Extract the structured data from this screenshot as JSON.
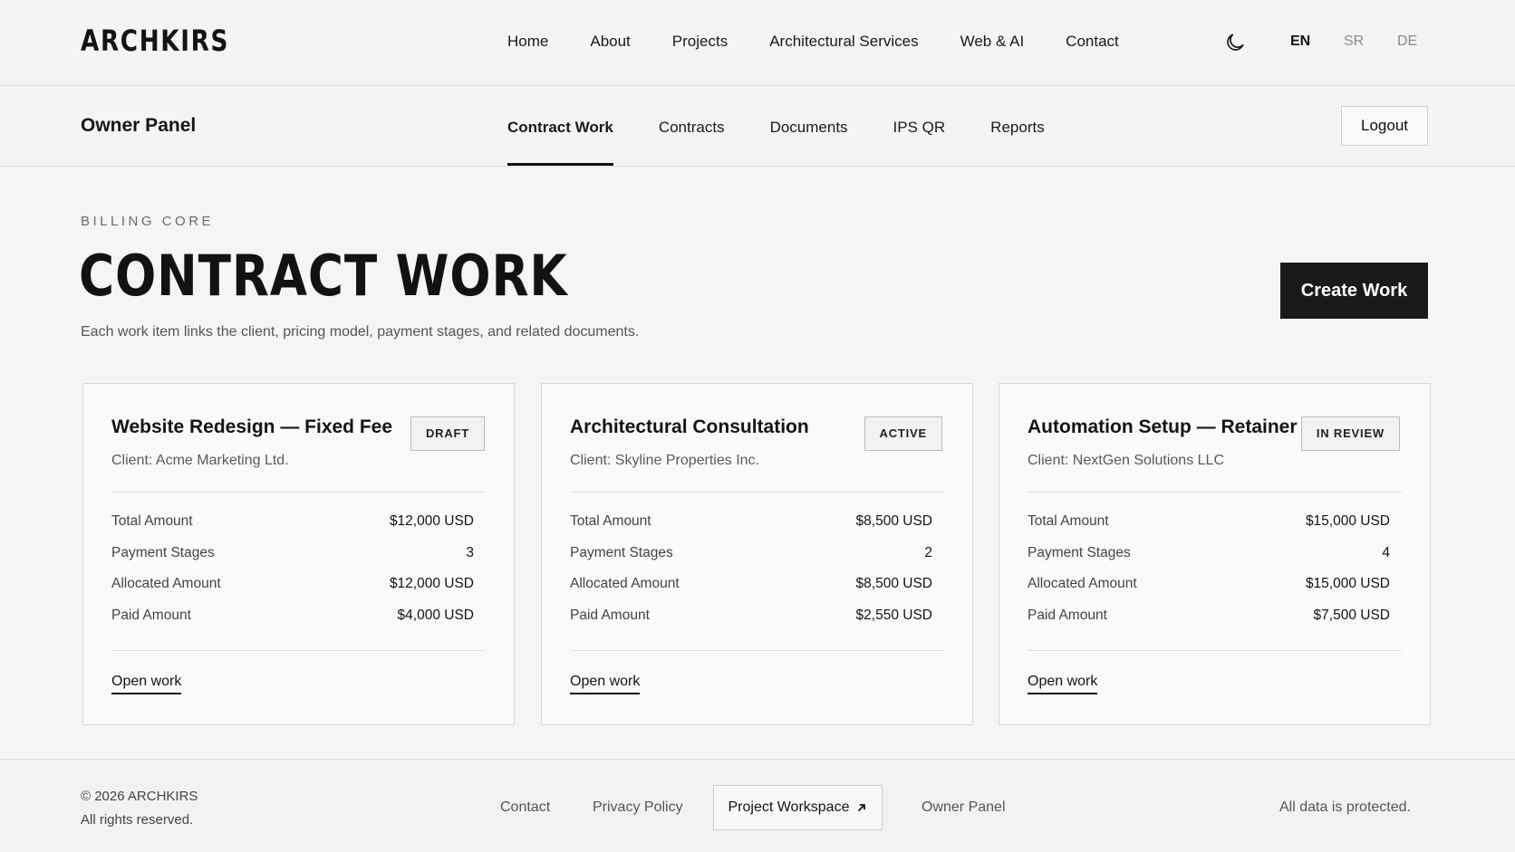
{
  "header": {
    "logo": "ARCHKIRS",
    "nav": [
      "Home",
      "About",
      "Projects",
      "Architectural Services",
      "Web & AI",
      "Contact"
    ],
    "theme_icon": "moon-icon",
    "languages": [
      "EN",
      "SR",
      "DE"
    ],
    "active_language": "EN"
  },
  "subheader": {
    "title": "Owner Panel",
    "tabs": [
      "Contract Work",
      "Contracts",
      "Documents",
      "IPS QR",
      "Reports"
    ],
    "active_tab": "Contract Work",
    "logout_label": "Logout"
  },
  "hero": {
    "eyebrow": "BILLING CORE",
    "title": "CONTRACT WORK",
    "description": "Each work item links the client, pricing model, payment stages, and related documents.",
    "create_label": "Create Work"
  },
  "labels": {
    "total": "Total Amount",
    "stages": "Payment Stages",
    "allocated": "Allocated Amount",
    "paid": "Paid Amount",
    "open": "Open work"
  },
  "cards": [
    {
      "title": "Website Redesign — Fixed Fee",
      "client": "Client: Acme Marketing Ltd.",
      "status": "DRAFT",
      "total": "$12,000 USD",
      "stages": "3",
      "allocated": "$12,000 USD",
      "paid": "$4,000 USD"
    },
    {
      "title": "Architectural Consultation",
      "client": "Client: Skyline Properties Inc.",
      "status": "ACTIVE",
      "total": "$8,500 USD",
      "stages": "2",
      "allocated": "$8,500 USD",
      "paid": "$2,550 USD"
    },
    {
      "title": "Automation Setup — Retainer",
      "client": "Client: NextGen Solutions LLC",
      "status": "IN REVIEW",
      "total": "$15,000 USD",
      "stages": "4",
      "allocated": "$15,000 USD",
      "paid": "$7,500 USD"
    }
  ],
  "footer": {
    "copyright": "© 2026 ARCHKIRS",
    "rights": "All rights reserved.",
    "contact": "Contact",
    "privacy": "Privacy Policy",
    "workspace": "Project Workspace",
    "workspace_icon": "arrow-up-right-icon",
    "owner_panel": "Owner Panel",
    "protected": "All data is protected."
  }
}
